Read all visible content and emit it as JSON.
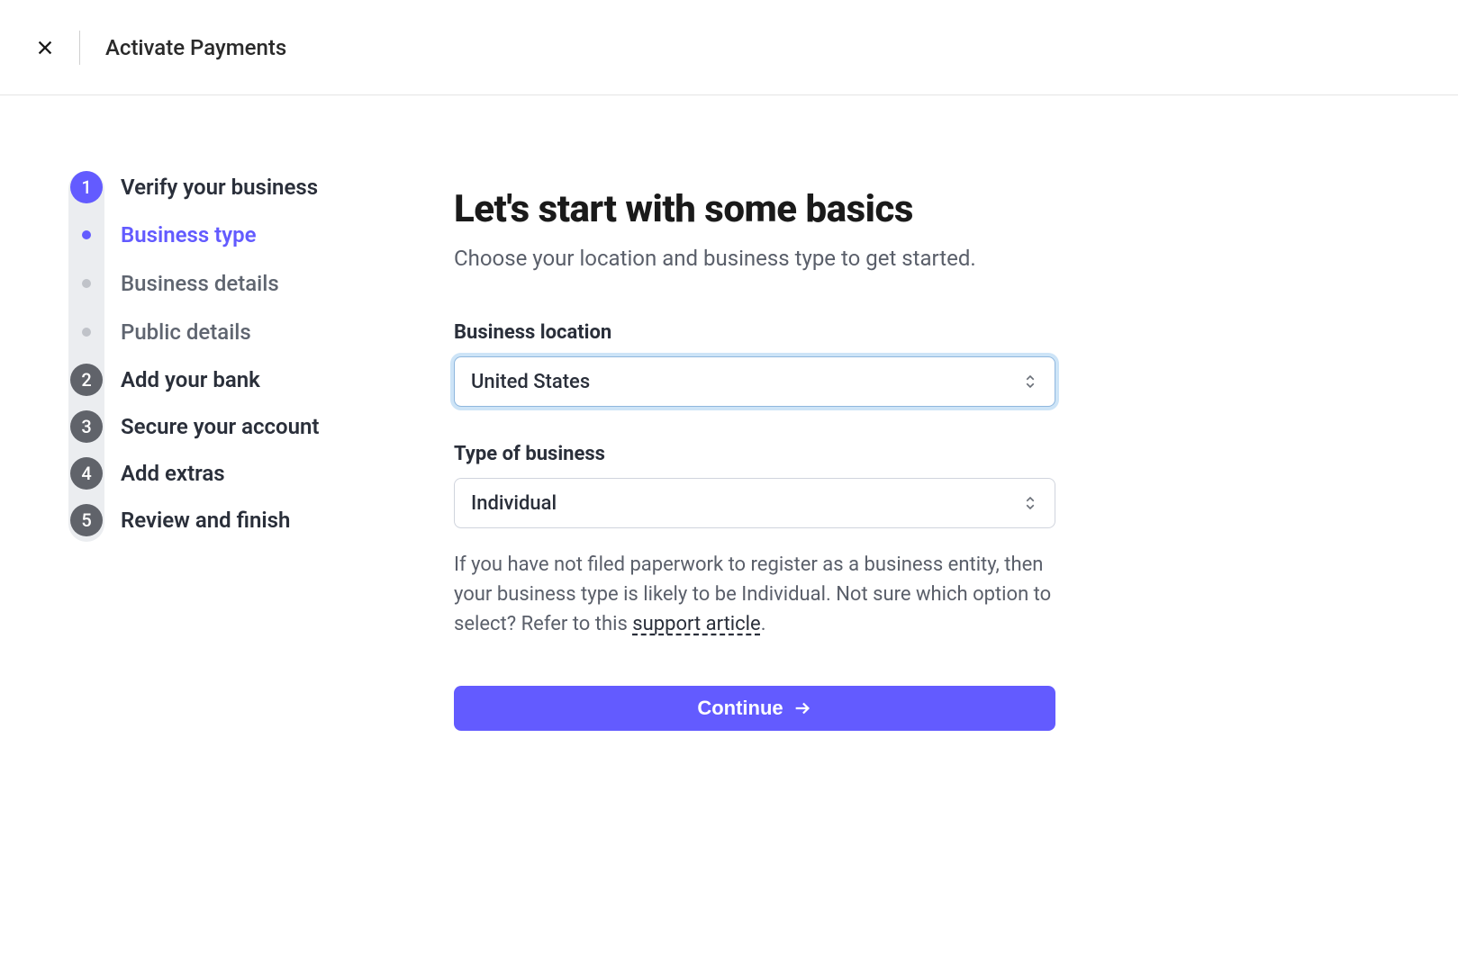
{
  "header": {
    "title": "Activate Payments"
  },
  "sidebar": {
    "steps": [
      {
        "number": "1",
        "label": "Verify your business",
        "active": true
      },
      {
        "number": "2",
        "label": "Add your bank",
        "active": false
      },
      {
        "number": "3",
        "label": "Secure your account",
        "active": false
      },
      {
        "number": "4",
        "label": "Add extras",
        "active": false
      },
      {
        "number": "5",
        "label": "Review and finish",
        "active": false
      }
    ],
    "substeps": [
      {
        "label": "Business type",
        "active": true
      },
      {
        "label": "Business details",
        "active": false
      },
      {
        "label": "Public details",
        "active": false
      }
    ]
  },
  "main": {
    "title": "Let's start with some basics",
    "subtitle": "Choose your location and business type to get started.",
    "fields": {
      "location": {
        "label": "Business location",
        "value": "United States"
      },
      "businessType": {
        "label": "Type of business",
        "value": "Individual"
      }
    },
    "help": {
      "text_before": "If you have not filed paperwork to register as a business entity, then your business type is likely to be Individual. Not sure which option to select? Refer to this ",
      "link": "support article",
      "text_after": "."
    },
    "continue_label": "Continue"
  },
  "colors": {
    "accent": "#635bff",
    "step_inactive": "#60636a",
    "focus_ring": "#cde4f7"
  }
}
